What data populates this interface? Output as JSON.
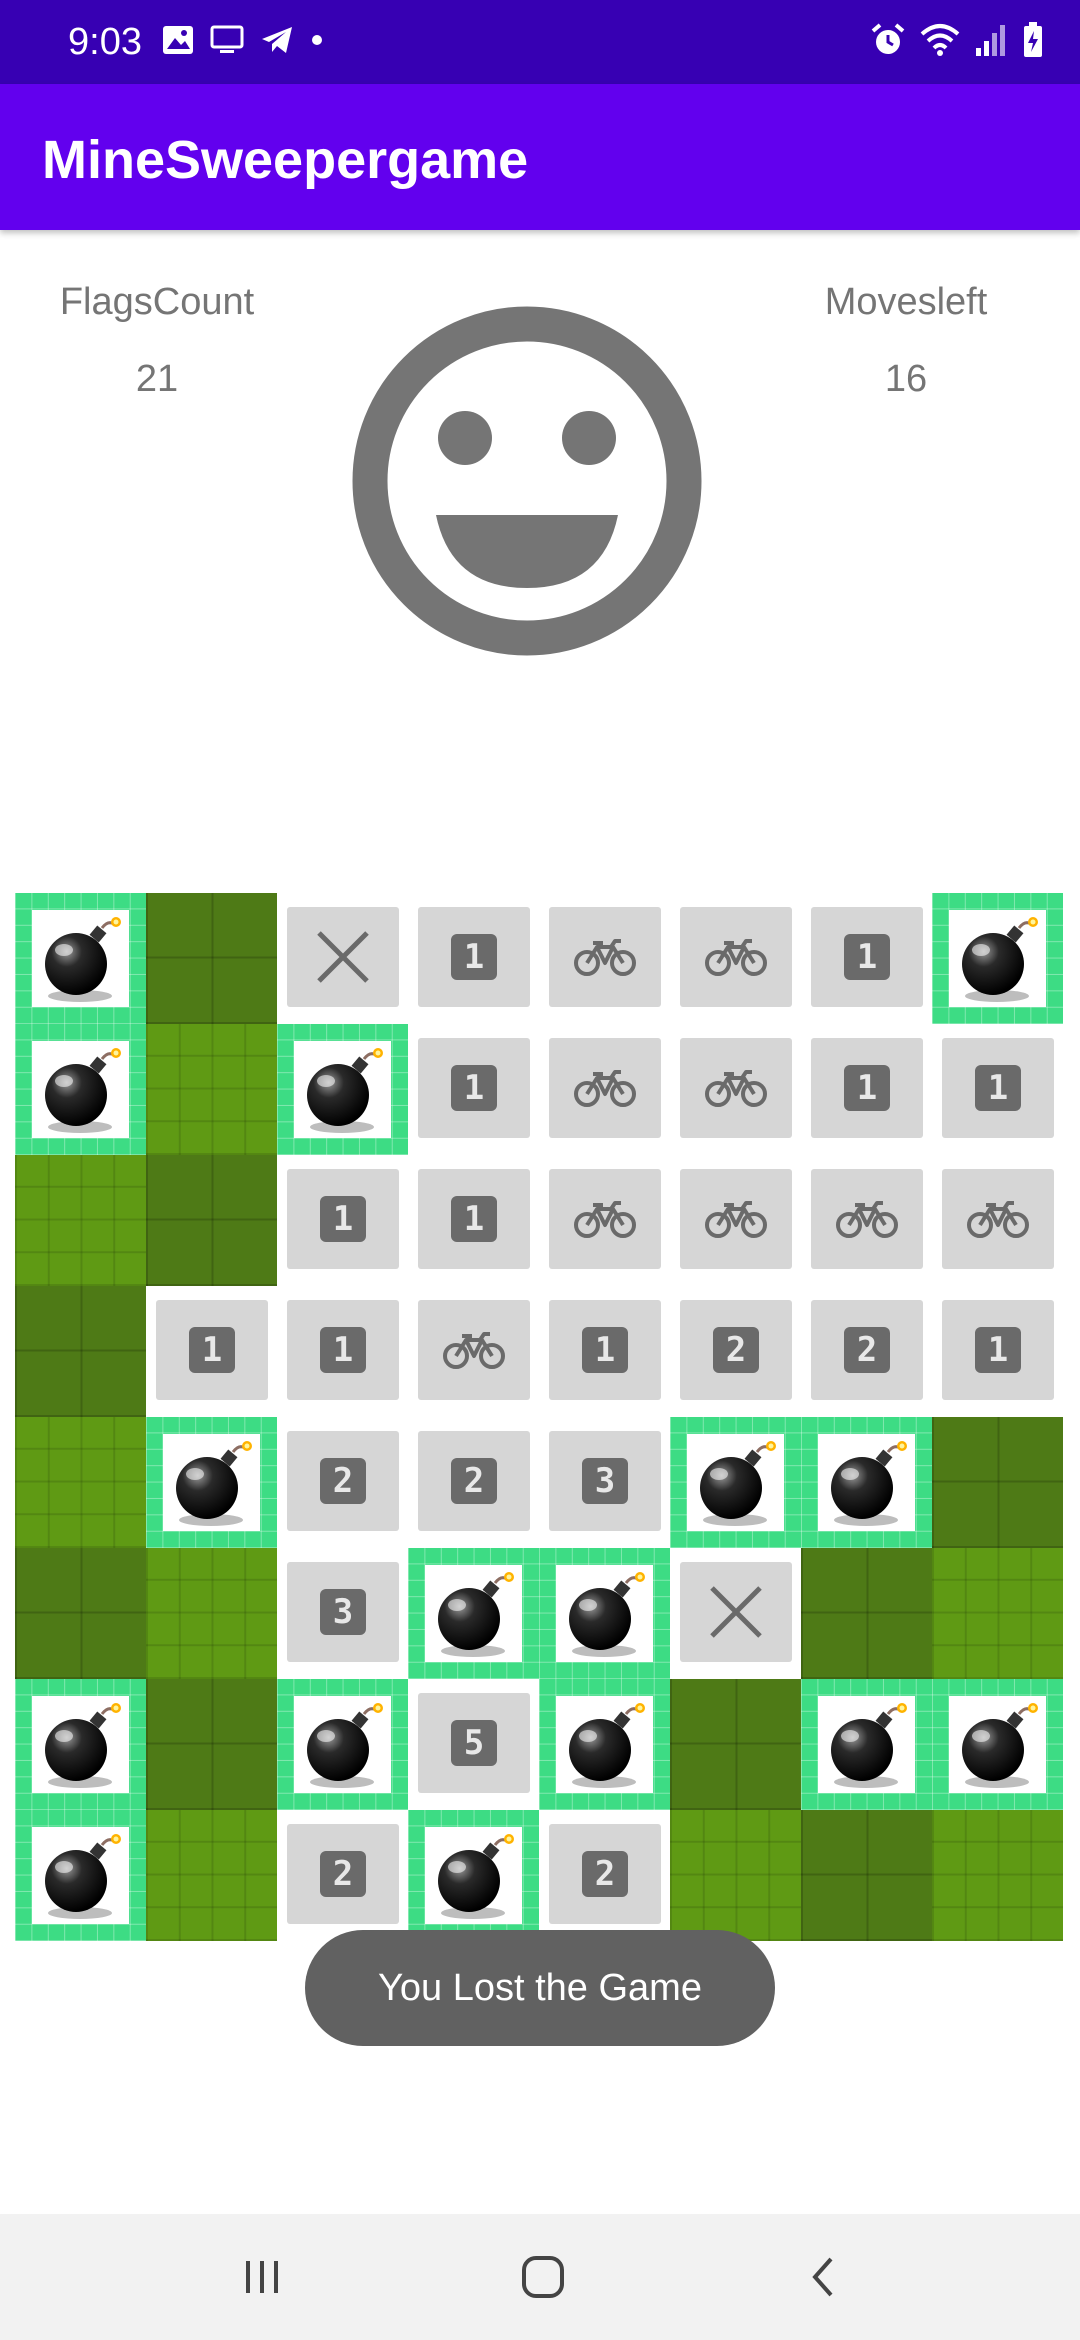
{
  "status_bar": {
    "time": "9:03",
    "left_icons": [
      "image-icon",
      "monitor-icon",
      "telegram-icon",
      "dot-icon"
    ],
    "right_icons": [
      "alarm-icon",
      "wifi-icon",
      "signal-icon",
      "battery-icon"
    ]
  },
  "app_bar": {
    "title": "MineSweepergame"
  },
  "stats": {
    "flags_label": "FlagsCount",
    "flags_value": "21",
    "moves_label": "Movesleft",
    "moves_value": "16"
  },
  "face": {
    "icon": "smiley-face-icon",
    "color": "#757575"
  },
  "board": {
    "rows": [
      [
        "mine",
        "covered-dark",
        "x",
        "1",
        "bike",
        "bike",
        "1",
        "mine"
      ],
      [
        "mine",
        "covered-light",
        "mine",
        "1",
        "bike",
        "bike",
        "1",
        "1"
      ],
      [
        "covered-light",
        "covered-dark",
        "1",
        "1",
        "bike",
        "bike",
        "bike",
        "bike"
      ],
      [
        "covered-dark",
        "1",
        "1",
        "bike",
        "1",
        "2",
        "2",
        "1"
      ],
      [
        "covered-light",
        "mine",
        "2",
        "2",
        "3",
        "mine",
        "mine",
        "covered-dark"
      ],
      [
        "covered-dark",
        "covered-light",
        "3",
        "mine",
        "mine",
        "x",
        "covered-dark",
        "covered-light"
      ],
      [
        "mine",
        "covered-dark",
        "mine",
        "5",
        "mine",
        "covered-dark",
        "mine",
        "mine"
      ],
      [
        "mine",
        "covered-light",
        "2",
        "mine",
        "2",
        "covered-light",
        "covered-dark",
        "covered-light"
      ]
    ],
    "colors": {
      "mine_background": "#3ddc84",
      "revealed_tile": "#d6d6d6",
      "number_badge": "#6a6a6a"
    }
  },
  "toast": {
    "message": "You Lost the Game"
  },
  "nav_bar": {
    "buttons": [
      "recent-apps-icon",
      "home-icon",
      "back-icon"
    ]
  },
  "colors": {
    "status_bar": "#3700b3",
    "app_bar": "#6200ee",
    "toast": "#616161"
  }
}
